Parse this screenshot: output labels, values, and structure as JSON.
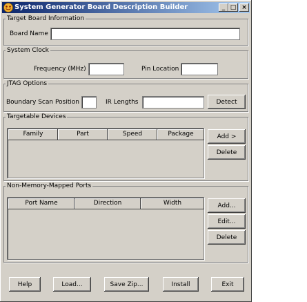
{
  "window": {
    "title": "System Generator Board Description Builder",
    "controls": {
      "minimize": "_",
      "maximize": "□",
      "close": "×"
    }
  },
  "target_board": {
    "legend": "Target Board Information",
    "board_name_label": "Board Name",
    "board_name_value": ""
  },
  "system_clock": {
    "legend": "System Clock",
    "frequency_label": "Frequency (MHz)",
    "frequency_value": "",
    "pin_location_label": "Pin Location",
    "pin_location_value": ""
  },
  "jtag": {
    "legend": "JTAG Options",
    "boundary_scan_label": "Boundary Scan Position",
    "boundary_scan_value": "",
    "ir_lengths_label": "IR Lengths",
    "ir_lengths_value": "",
    "detect_label": "Detect"
  },
  "targetable_devices": {
    "legend": "Targetable Devices",
    "columns": [
      "Family",
      "Part",
      "Speed",
      "Package"
    ],
    "add_label": "Add >",
    "delete_label": "Delete"
  },
  "ports": {
    "legend": "Non-Memory-Mapped Ports",
    "columns": [
      "Port Name",
      "Direction",
      "Width"
    ],
    "add_label": "Add...",
    "edit_label": "Edit...",
    "delete_label": "Delete"
  },
  "footer": {
    "help_label": "Help",
    "load_label": "Load...",
    "save_zip_label": "Save Zip...",
    "install_label": "Install",
    "exit_label": "Exit"
  }
}
